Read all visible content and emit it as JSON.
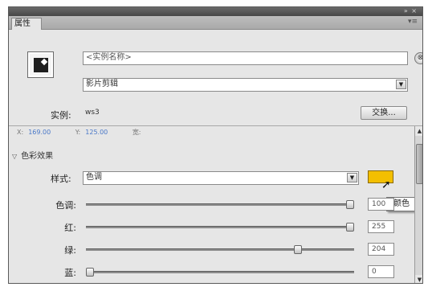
{
  "panel": {
    "tab_label": "属性",
    "tab_menu_icon": "panel-menu-icon",
    "window_controls": "» ×"
  },
  "symbol": {
    "icon": "movieclip-symbol-icon",
    "instance_name_placeholder": "<实例名称>",
    "symbol_type": "影片剪辑",
    "instance_label": "实例:",
    "instance_value": "ws3",
    "swap_button": "交换..."
  },
  "position_size": {
    "x_label": "X:",
    "x_value": "169.00",
    "y_label": "Y:",
    "y_value": "125.00",
    "w_label": "宽:"
  },
  "color_effect": {
    "section_title": "色彩效果",
    "style_label": "样式:",
    "style_value": "色调",
    "tint_color": "#f3bf00",
    "tooltip": "颜色",
    "sliders": [
      {
        "label": "色调:",
        "value": "100",
        "level_pct": 100
      },
      {
        "label": "红:",
        "value": "255",
        "level_pct": 100
      },
      {
        "label": "绿:",
        "value": "204",
        "level_pct": 80
      },
      {
        "label": "蓝:",
        "value": "0",
        "level_pct": 0
      }
    ]
  }
}
